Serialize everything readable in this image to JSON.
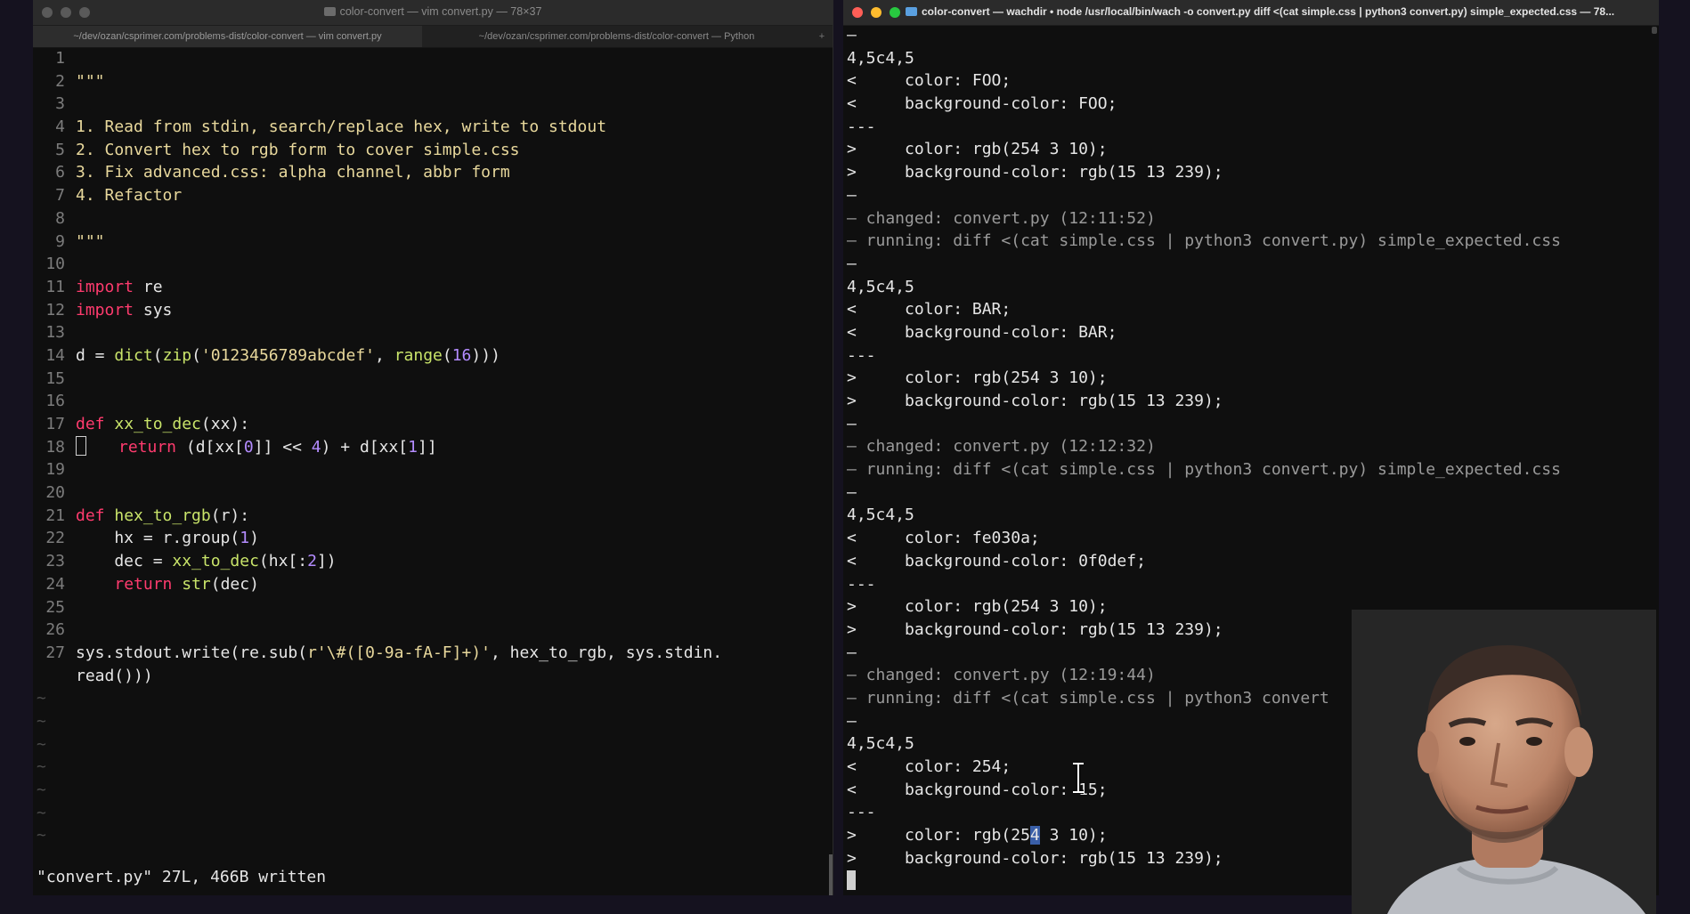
{
  "left_window": {
    "title": "color-convert — vim convert.py — 78×37",
    "tabs": [
      "~/dev/ozan/csprimer.com/problems-dist/color-convert — vim convert.py",
      "~/dev/ozan/csprimer.com/problems-dist/color-convert — Python"
    ],
    "tab_plus": "+",
    "code": [
      {
        "n": "1",
        "t": ""
      },
      {
        "n": "2",
        "t": "\"\"\""
      },
      {
        "n": "3",
        "t": ""
      },
      {
        "n": "4",
        "t": "1. Read from stdin, search/replace hex, write to stdout"
      },
      {
        "n": "5",
        "t": "2. Convert hex to rgb form to cover simple.css"
      },
      {
        "n": "6",
        "t": "3. Fix advanced.css: alpha channel, abbr form"
      },
      {
        "n": "7",
        "t": "4. Refactor"
      },
      {
        "n": "8",
        "t": ""
      },
      {
        "n": "9",
        "t": "\"\"\""
      },
      {
        "n": "10",
        "t": ""
      },
      {
        "n": "11",
        "t": "import re"
      },
      {
        "n": "12",
        "t": "import sys"
      },
      {
        "n": "13",
        "t": ""
      },
      {
        "n": "14",
        "t": "d = dict(zip('0123456789abcdef', range(16)))"
      },
      {
        "n": "15",
        "t": ""
      },
      {
        "n": "16",
        "t": ""
      },
      {
        "n": "17",
        "t": "def xx_to_dec(xx):"
      },
      {
        "n": "18",
        "t": "return (d[xx[0]] << 4) + d[xx[1]]"
      },
      {
        "n": "19",
        "t": ""
      },
      {
        "n": "20",
        "t": ""
      },
      {
        "n": "21",
        "t": "def hex_to_rgb(r):"
      },
      {
        "n": "22",
        "t": "    hx = r.group(1)"
      },
      {
        "n": "23",
        "t": "    dec = xx_to_dec(hx[:2])"
      },
      {
        "n": "24",
        "t": "    return str(dec)"
      },
      {
        "n": "25",
        "t": ""
      },
      {
        "n": "26",
        "t": ""
      },
      {
        "n": "27",
        "t": "sys.stdout.write(re.sub(r'\\#([0-9a-fA-F]+)', hex_to_rgb, sys.stdin."
      },
      {
        "n": "",
        "t": "read()))"
      }
    ],
    "tilde": "~",
    "status": "\"convert.py\" 27L, 466B written"
  },
  "right_window": {
    "title": "color-convert — wachdir • node /usr/local/bin/wach -o convert.py diff <(cat simple.css | python3 convert.py) simple_expected.css — 78...",
    "lines": [
      "—",
      "4,5c4,5",
      "<     color: FOO;",
      "<     background-color: FOO;",
      "---",
      ">     color: rgb(254 3 10);",
      ">     background-color: rgb(15 13 239);",
      "—",
      "– changed: convert.py (12:11:52)",
      "– running: diff <(cat simple.css | python3 convert.py) simple_expected.css",
      "—",
      "4,5c4,5",
      "<     color: BAR;",
      "<     background-color: BAR;",
      "---",
      ">     color: rgb(254 3 10);",
      ">     background-color: rgb(15 13 239);",
      "—",
      "– changed: convert.py (12:12:32)",
      "– running: diff <(cat simple.css | python3 convert.py) simple_expected.css",
      "—",
      "4,5c4,5",
      "<     color: fe030a;",
      "<     background-color: 0f0def;",
      "---",
      ">     color: rgb(254 3 10);",
      ">     background-color: rgb(15 13 239);",
      "—",
      "– changed: convert.py (12:19:44)",
      "– running: diff <(cat simple.css | python3 convert",
      "—",
      "4,5c4,5",
      "<     color: 254;",
      "<     background-color: 15;",
      "---",
      ">     color: rgb(254 3 10);",
      ">     background-color: rgb(15 13 239);"
    ]
  },
  "colors": {
    "keyword": "#ff3b6e",
    "function": "#c9e46a",
    "string": "#e8d89c",
    "number": "#b48cff"
  }
}
